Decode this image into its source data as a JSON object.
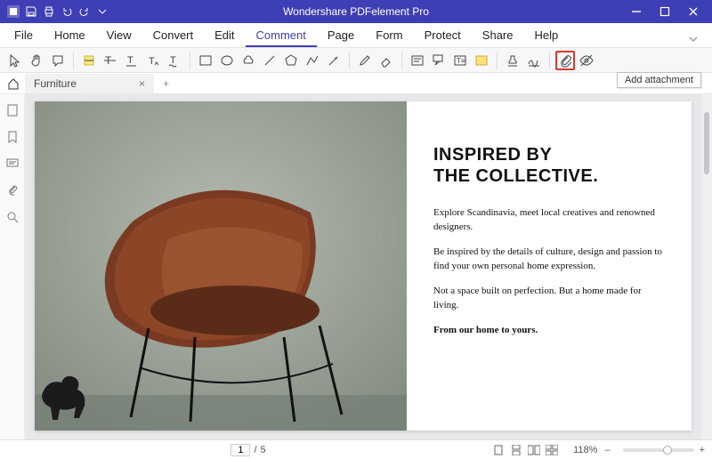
{
  "app": {
    "title": "Wondershare PDFelement Pro"
  },
  "menu": {
    "file": "File",
    "home": "Home",
    "view": "View",
    "convert": "Convert",
    "edit": "Edit",
    "comment": "Comment",
    "page": "Page",
    "form": "Form",
    "protect": "Protect",
    "share": "Share",
    "help": "Help"
  },
  "tooltip": {
    "add_attachment": "Add attachment"
  },
  "tab": {
    "name": "Furniture",
    "close": "×",
    "plus": "+"
  },
  "doc": {
    "heading_l1": "INSPIRED BY",
    "heading_l2": "THE COLLECTIVE.",
    "p1": "Explore Scandinavia, meet local creatives and renowned designers.",
    "p2": "Be inspired by the details of culture, design and passion to find your own personal home expression.",
    "p3": "Not a space built on perfection. But a home made for living.",
    "p4": "From our home to yours."
  },
  "status": {
    "page_current": "1",
    "page_sep": "/",
    "page_total": "5",
    "zoom": "118%",
    "minus": "–",
    "plus": "+"
  }
}
